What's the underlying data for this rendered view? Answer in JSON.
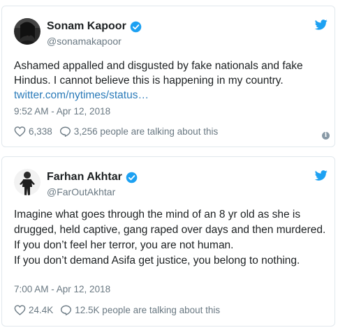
{
  "colors": {
    "link": "#2b7bb9",
    "verified": "#1da1f2",
    "twitter_bird": "#1da1f2",
    "meta_text": "#697882"
  },
  "tweets": [
    {
      "name": "Sonam Kapoor",
      "handle": "@sonamakapoor",
      "text_lines": [
        "Ashamed appalled and disgusted by fake nationals and fake Hindus. I cannot believe this is happening in my country."
      ],
      "link": "twitter.com/nytimes/status…",
      "timestamp": "9:52 AM - Apr 12, 2018",
      "likes": "6,338",
      "replies_text": "3,256 people are talking about this"
    },
    {
      "name": "Farhan Akhtar",
      "handle": "@FarOutAkhtar",
      "text_lines": [
        "Imagine what goes through the mind of an 8 yr old as she is drugged, held captive, gang raped over days and then murdered.",
        "If you don’t feel her terror, you are not human.",
        "If you don’t demand Asifa get justice, you belong to nothing."
      ],
      "timestamp": "7:00 AM - Apr 12, 2018",
      "likes": "24.4K",
      "replies_text": "12.5K people are talking about this"
    }
  ],
  "icons": {
    "verified": "verified-badge-icon",
    "bird": "twitter-bird-icon",
    "like": "heart-icon",
    "reply": "speech-bubble-icon",
    "info": "info-icon"
  }
}
